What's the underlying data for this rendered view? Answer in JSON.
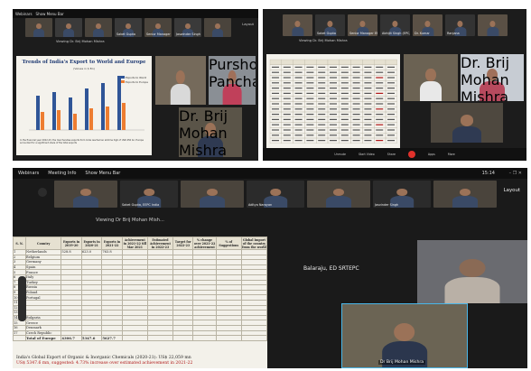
{
  "shot1": {
    "top_bar": [
      "Webinars",
      "Show Menu Bar"
    ],
    "strip": [
      {
        "name": ""
      },
      {
        "name": ""
      },
      {
        "name": ""
      },
      {
        "name": "Saket Gupta"
      },
      {
        "name": "Senior Manager EPC India"
      },
      {
        "name": "Jaswinder Singh"
      },
      {
        "name": ""
      }
    ],
    "viewing": "Viewing Dr. Brij Mohan Mishra",
    "layout": "Layout",
    "slide_title": "Trends of India's Export to World and Europe",
    "slide_subtitle": "(Values in $ Bn)",
    "legend": [
      "Exports to World",
      "Exports to Europe"
    ],
    "cam_names": [
      "",
      "Purshottam Panchal",
      "Dr. Brij Mohan Mishra"
    ],
    "caption": "In the financial year 2022-23, the merchandise exports from India reached an all-time high of USD 450 bn; Europe accounted for a significant share of the total exports"
  },
  "shot2": {
    "strip": [
      {
        "name": ""
      },
      {
        "name": "Saket Gupta"
      },
      {
        "name": "Senior Manager EPC India"
      },
      {
        "name": "Abhijit Singh (EPC, SG)"
      },
      {
        "name": "Dr. Kumar"
      },
      {
        "name": "Ranjana"
      },
      {
        "name": ""
      }
    ],
    "viewing": "Viewing Dr. Brij Mohan Mishra",
    "cam_names": [
      "",
      "Dr. Brij Mohan Mishra",
      ""
    ],
    "controls": [
      "Unmute",
      "Start Video",
      "Share",
      "",
      "Apps",
      "More"
    ]
  },
  "shot3": {
    "top_bar": [
      "Webinars",
      "Meeting Info",
      "Show Menu Bar"
    ],
    "time": "15:14",
    "layout": "Layout",
    "strip": [
      {
        "name": ""
      },
      {
        "name": "Saket Gupta, EEPC India"
      },
      {
        "name": ""
      },
      {
        "name": "Aditya Narayan"
      },
      {
        "name": ""
      },
      {
        "name": "Jasvinder Singh"
      },
      {
        "name": ""
      }
    ],
    "viewing": "Viewing Dr Brij Mohan Mish...",
    "side_name": "Balaraju, ED SRTEPC",
    "main_cam_name": "Dr Brij Mohan Mishra",
    "table_headers": [
      "S. N.",
      "Country",
      "Exports in 2019-20",
      "Exports in 2020-21",
      "Exports in 2021-22",
      "Achievement in 2021-22 till Mar 2021",
      "Estimated Achievement in 2022-23",
      "Target for 2022-23",
      "% change over 2021-22 achievement",
      "% of Suggestions",
      "Global Import of the country from the world"
    ],
    "rows": [
      {
        "n": "1",
        "c": "Netherlands",
        "v": [
          "528.8",
          "623.0",
          "763.8",
          "",
          "",
          "",
          "",
          "",
          ""
        ]
      },
      {
        "n": "2",
        "c": "Belgium",
        "v": [
          "",
          "",
          "",
          "",
          "",
          "",
          "",
          "",
          ""
        ]
      },
      {
        "n": "3",
        "c": "Germany",
        "v": [
          "",
          "",
          "",
          "",
          "",
          "",
          "",
          "",
          ""
        ]
      },
      {
        "n": "4",
        "c": "Spain",
        "v": [
          "",
          "",
          "",
          "",
          "",
          "",
          "",
          "",
          ""
        ]
      },
      {
        "n": "5",
        "c": "France",
        "v": [
          "",
          "",
          "",
          "",
          "",
          "",
          "",
          "",
          ""
        ]
      },
      {
        "n": "6",
        "c": "Italy",
        "v": [
          "",
          "",
          "",
          "",
          "",
          "",
          "",
          "",
          ""
        ]
      },
      {
        "n": "7",
        "c": "Turkey",
        "v": [
          "",
          "",
          "",
          "",
          "",
          "",
          "",
          "",
          ""
        ]
      },
      {
        "n": "8",
        "c": "Russia",
        "v": [
          "",
          "",
          "",
          "",
          "",
          "",
          "",
          "",
          ""
        ]
      },
      {
        "n": "9",
        "c": "Poland",
        "v": [
          "",
          "",
          "",
          "",
          "",
          "",
          "",
          "",
          ""
        ]
      },
      {
        "n": "10",
        "c": "Portugal",
        "v": [
          "",
          "",
          "",
          "",
          "",
          "",
          "",
          "",
          ""
        ]
      },
      {
        "n": "11",
        "c": "",
        "v": [
          "",
          "",
          "",
          "",
          "",
          "",
          "",
          "",
          ""
        ]
      },
      {
        "n": "12",
        "c": "",
        "v": [
          "",
          "",
          "",
          "",
          "",
          "",
          "",
          "",
          ""
        ]
      },
      {
        "n": "13",
        "c": "",
        "v": [
          "",
          "",
          "",
          "",
          "",
          "",
          "",
          "",
          ""
        ]
      },
      {
        "n": "14",
        "c": "Bulgaria",
        "v": [
          "",
          "",
          "",
          "",
          "",
          "",
          "",
          "",
          ""
        ]
      },
      {
        "n": "15",
        "c": "Greece",
        "v": [
          "",
          "",
          "",
          "",
          "",
          "",
          "",
          "",
          ""
        ]
      },
      {
        "n": "16",
        "c": "Denmark",
        "v": [
          "",
          "",
          "",
          "",
          "",
          "",
          "",
          "",
          ""
        ]
      },
      {
        "n": "17",
        "c": "Czech Republic",
        "v": [
          "",
          "",
          "",
          "",
          "",
          "",
          "",
          "",
          ""
        ]
      }
    ],
    "total_row": {
      "label": "Total of Europe",
      "v": [
        "4306.7",
        "5347.6",
        "5627.7",
        "",
        "",
        "",
        "",
        "",
        ""
      ]
    },
    "footnote_1": "India's Global Export of Organic & Inorganic Chemicals (2020-21): US$ 22,059 mn",
    "footnote_2": "US$ 5347.6 mn, suggested: 4.73% increase over estimated achievement in 2021-22"
  },
  "colors": {
    "app_bg": "#1c1c1c",
    "bar_bg": "#0f0f0f",
    "tile_bg": "#2b2b2b",
    "series_world": "#2f5597",
    "series_europe": "#ed7d31",
    "slide_bg": "#f4f2ec",
    "title_blue": "#1f3a73"
  }
}
